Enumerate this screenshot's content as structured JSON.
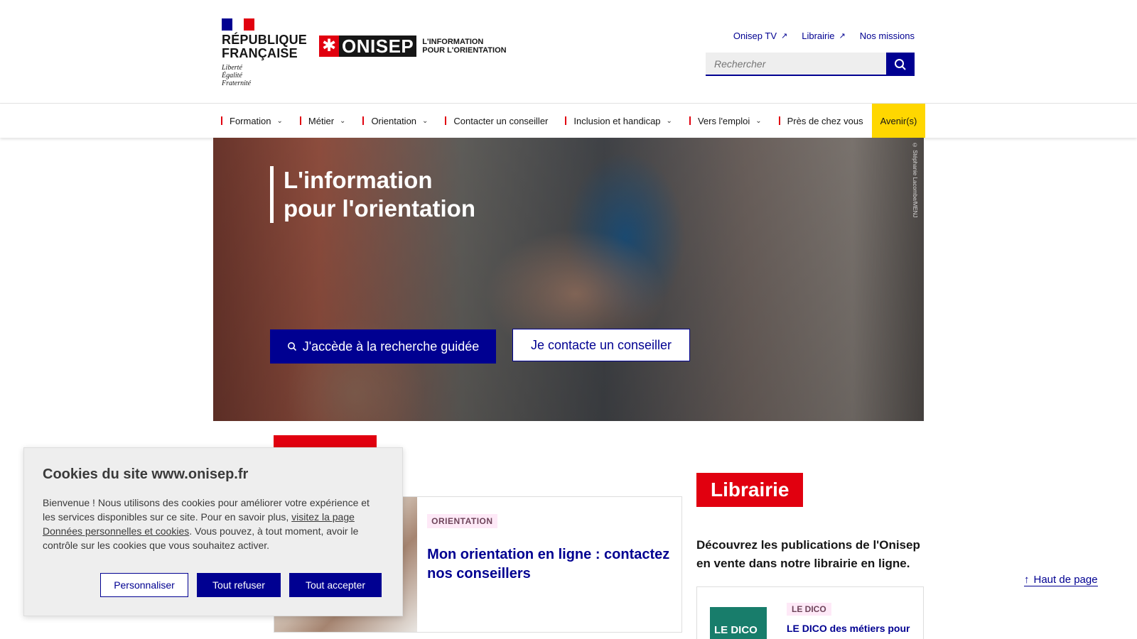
{
  "header": {
    "rf_name_line1": "RÉPUBLIQUE",
    "rf_name_line2": "FRANÇAISE",
    "rf_motto_1": "Liberté",
    "rf_motto_2": "Égalité",
    "rf_motto_3": "Fraternité",
    "onisep_word": "ONISEP",
    "onisep_tag_1": "L'INFORMATION",
    "onisep_tag_2": "POUR L'ORIENTATION",
    "links": [
      "Onisep TV",
      "Librairie",
      "Nos missions"
    ],
    "search_placeholder": "Rechercher"
  },
  "nav": {
    "items": [
      "Formation",
      "Métier",
      "Orientation",
      "Contacter un conseiller",
      "Inclusion et handicap",
      "Vers l'emploi",
      "Près de chez vous",
      "Avenir(s)"
    ]
  },
  "hero": {
    "title_1": "L'information",
    "title_2": "pour l'orientation",
    "credit": "© Stéphanie Lacombe/MENJ",
    "btn_primary": "J'accède à la recherche guidée",
    "btn_secondary": "Je contacte un conseiller"
  },
  "article": {
    "badge": "ORIENTATION",
    "title": "Mon orientation en ligne : contactez nos conseillers"
  },
  "librairie": {
    "heading": "Librairie",
    "text": "Découvrez les publications de l'Onisep en vente dans notre librairie en ligne.",
    "card_badge": "LE DICO",
    "card_thumb": "LE DICO",
    "card_title": "LE DICO des métiers pour"
  },
  "back_to_top": "Haut de page",
  "cookie": {
    "title": "Cookies du site www.onisep.fr",
    "text_before": "Bienvenue ! Nous utilisons des cookies pour améliorer votre expérience et les services disponibles sur ce site. Pour en savoir plus, ",
    "link": "visitez la page Données personnelles et cookies",
    "text_after": ". Vous pouvez, à tout moment, avoir le contrôle sur les cookies que vous souhaitez activer.",
    "btn_customize": "Personnaliser",
    "btn_refuse": "Tout refuser",
    "btn_accept": "Tout accepter"
  },
  "colors": {
    "primary": "#000091",
    "red": "#e1000f",
    "yellow": "#ffd700"
  }
}
